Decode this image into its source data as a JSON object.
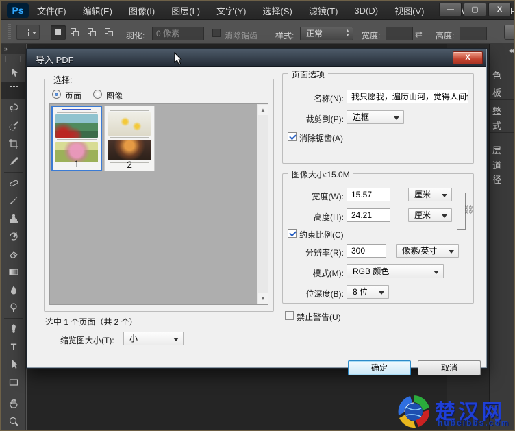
{
  "window": {
    "logo": "Ps",
    "menus": [
      "文件(F)",
      "编辑(E)",
      "图像(I)",
      "图层(L)",
      "文字(Y)",
      "选择(S)",
      "滤镜(T)",
      "3D(D)",
      "视图(V)",
      "窗口(W)",
      "帮助(H"
    ],
    "controls": {
      "minimize": "—",
      "maximize": "▢",
      "close": "X"
    }
  },
  "options_bar": {
    "feather_label": "羽化:",
    "feather_value": "0 像素",
    "antialias_label": "消除锯齿",
    "style_label": "样式:",
    "style_value": "正常",
    "width_label": "宽度:",
    "height_label": "高度:"
  },
  "toolbar_tools": [
    "move-tool",
    "rectangular-marquee-tool",
    "lasso-tool",
    "quick-selection-tool",
    "crop-tool",
    "eyedropper-tool",
    "healing-brush-tool",
    "brush-tool",
    "clone-stamp-tool",
    "history-brush-tool",
    "eraser-tool",
    "gradient-tool",
    "blur-tool",
    "dodge-tool",
    "pen-tool",
    "type-tool",
    "path-selection-tool",
    "shape-tool",
    "hand-tool",
    "zoom-tool"
  ],
  "right_dock": {
    "tabs": [
      "色",
      "板",
      "整",
      "式",
      "层",
      "道",
      "径"
    ]
  },
  "dialog": {
    "title": "导入 PDF",
    "close_label": "X",
    "select_group": {
      "legend": "选择:",
      "radio_page": "页面",
      "radio_image": "图像",
      "pages": [
        {
          "num": "1"
        },
        {
          "num": "2"
        }
      ],
      "selected_info": "选中 1 个页面（共 2 个）",
      "thumb_size_label": "缩览图大小(T):",
      "thumb_size_value": "小"
    },
    "page_options": {
      "legend": "页面选项",
      "name_label": "名称(N):",
      "name_value": "我只愿我，遍历山河，觉得人间值",
      "crop_label": "裁剪到(P):",
      "crop_value": "边框",
      "antialias_label": "消除锯齿(A)"
    },
    "image_size": {
      "legend": "图像大小:15.0M",
      "width_label": "宽度(W):",
      "width_value": "15.57",
      "width_unit": "厘米",
      "height_label": "高度(H):",
      "height_value": "24.21",
      "height_unit": "厘米",
      "constrain_label": "约束比例(C)",
      "resolution_label": "分辨率(R):",
      "resolution_value": "300",
      "resolution_unit": "像素/英寸",
      "mode_label": "模式(M):",
      "mode_value": "RGB 颜色",
      "depth_label": "位深度(B):",
      "depth_value": "8 位"
    },
    "suppress_label": "禁止警告(U)",
    "ok_label": "确定",
    "cancel_label": "取消"
  },
  "watermark": {
    "title": "楚汉网",
    "domain": "hubeibbs.com"
  },
  "colors": {
    "accent_blue": "#3b7bd4",
    "ps_blue": "#31a8ff",
    "close_red": "#c3432f",
    "watermark_blue": "#1f3fd6"
  }
}
